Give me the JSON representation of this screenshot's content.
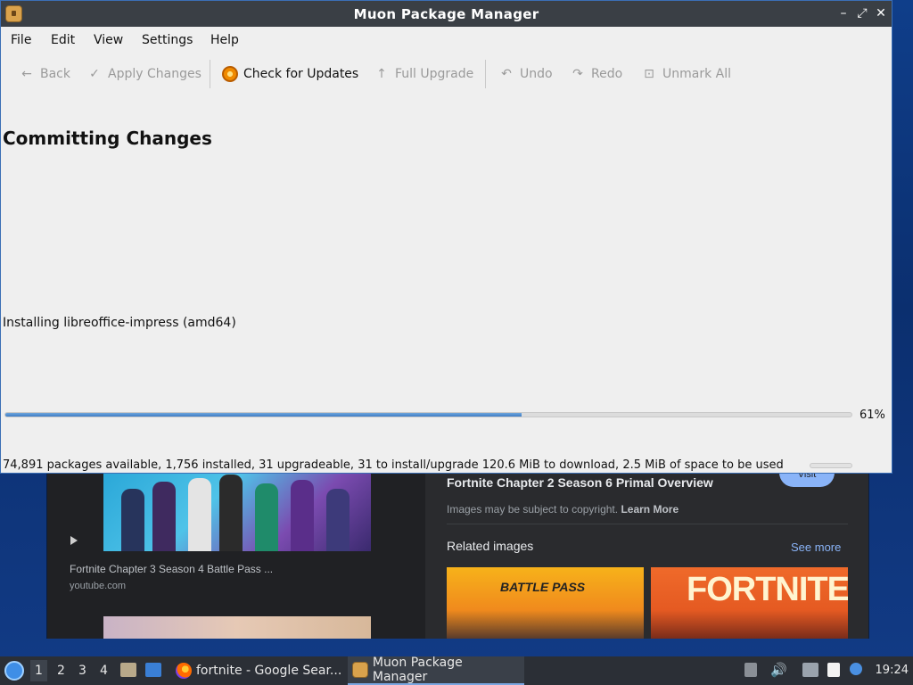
{
  "window": {
    "title": "Muon Package Manager",
    "controls": {
      "minimize": "–",
      "maximize": "⤢",
      "close": "✕"
    }
  },
  "menu": [
    "File",
    "Edit",
    "View",
    "Settings",
    "Help"
  ],
  "toolbar": {
    "back": "Back",
    "apply": "Apply Changes",
    "check_updates": "Check for Updates",
    "full_upgrade": "Full Upgrade",
    "undo": "Undo",
    "redo": "Redo",
    "unmark_all": "Unmark All"
  },
  "main": {
    "heading": "Committing Changes",
    "status": "Installing libreoffice-impress (amd64)",
    "progress": {
      "value": 0.61,
      "label": "61%"
    }
  },
  "statusbar": {
    "text": "74,891 packages available, 1,756 installed, 31 upgradeable, 31 to install/upgrade 120.6 MiB to download, 2.5 MiB of space to be used"
  },
  "browser_bg": {
    "result_title": "Fortnite Chapter 3 Season 4 Battle Pass ...",
    "result_source": "youtube.com",
    "visit_label": "Visit",
    "side_title": "Fortnite Chapter 2 Season 6 Primal Overview",
    "copyright_text": "Images may be subject to copyright.",
    "learn_more": "Learn More",
    "related_label": "Related images",
    "see_more": "See more",
    "rel1_text": "BATTLE PASS",
    "rel2_text": "FORTNITE"
  },
  "taskbar": {
    "workspaces": [
      "1",
      "2",
      "3",
      "4"
    ],
    "tasks": [
      {
        "label": "fortnite - Google Sear..."
      },
      {
        "label": "Muon Package Manager"
      }
    ],
    "clock": "19:24"
  },
  "colors": {
    "accent": "#3d7cc5",
    "titlebar": "#3a3f45",
    "taskbar": "#2b2f36",
    "browser_bg": "#202124",
    "link": "#8ab4f8"
  }
}
